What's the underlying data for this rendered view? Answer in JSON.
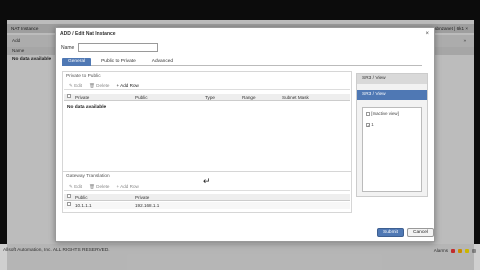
{
  "background": {
    "window_title": "NAT Instance",
    "window_right_text": "abnzanet | 6k1 ×",
    "toolbar_add": "Add",
    "toolbar_right": "»",
    "tab_label": "Name",
    "no_data": "No data available",
    "footer_text": "Allsoft Automation, Inc. ALL RIGHTS RESERVED.",
    "footer_alarms": "Alarms"
  },
  "dialog": {
    "title": "ADD / Edit Nat Instance",
    "close_glyph": "×",
    "name_label": "Name",
    "name_value": "",
    "tabs": [
      {
        "label": "General",
        "active": true
      },
      {
        "label": "Public to Private",
        "active": false
      },
      {
        "label": "Advanced",
        "active": false
      }
    ],
    "private_to_public": {
      "title": "Private to Public",
      "toolbar": {
        "edit": "Edit",
        "delete": "Delete",
        "add_row": "Add Row"
      },
      "columns": [
        "Private",
        "Public",
        "Type",
        "Range",
        "Subnet Mask"
      ],
      "no_data": "No data available"
    },
    "gateway_translation": {
      "title": "Gateway Translation",
      "toolbar": {
        "edit": "Edit",
        "delete": "Delete",
        "add_row": "Add Row"
      },
      "columns": [
        "Public",
        "Private"
      ],
      "rows": [
        {
          "public": "10.1.1.1",
          "private": "192.168.1.1"
        }
      ]
    },
    "views": {
      "header1": "SR3 / View",
      "header2": "SR3 / View",
      "items": [
        {
          "label": "[Inactive view]",
          "checked": false
        },
        {
          "label": "1",
          "checked": true
        }
      ]
    },
    "submit_label": "Submit",
    "cancel_label": "Cancel"
  },
  "colors": {
    "accent": "#4f78b4",
    "dialog_bg": "#ffffff",
    "app_bg": "#d7d7d7"
  }
}
